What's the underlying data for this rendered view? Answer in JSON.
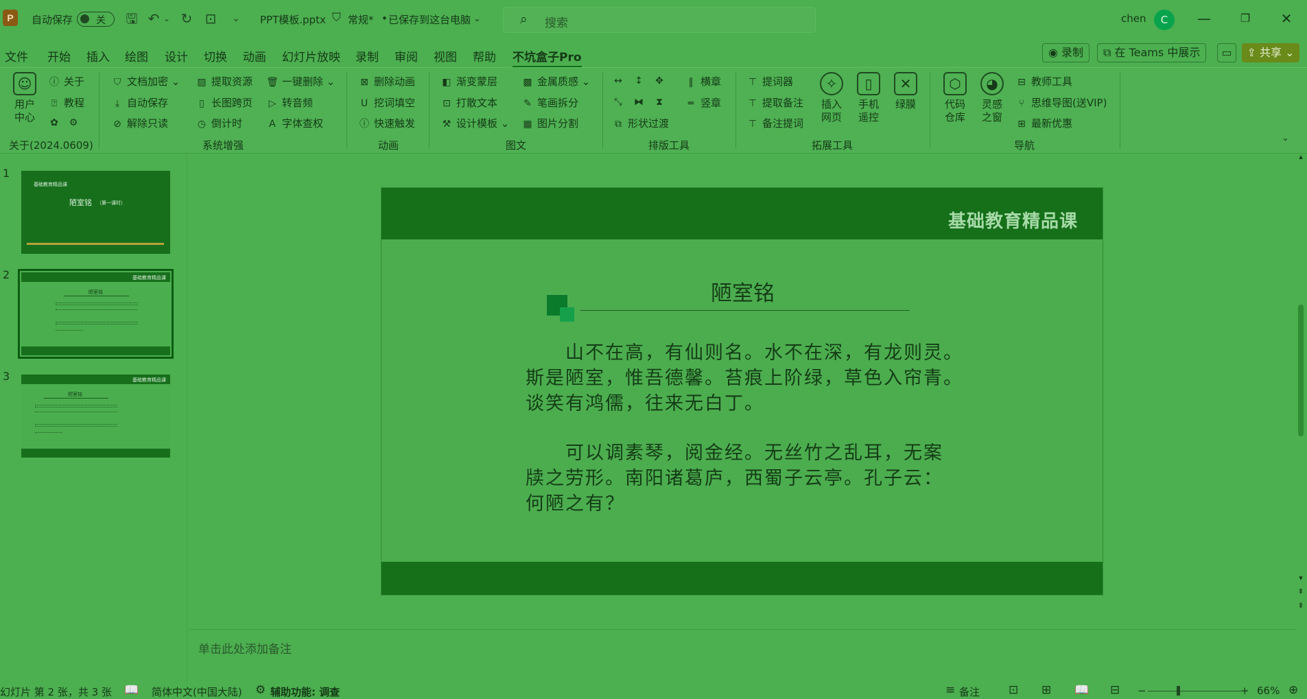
{
  "titlebar": {
    "autosave_label": "自动保存",
    "autosave_state": "关",
    "filename": "PPT模板.pptx",
    "sensitivity": "常规*",
    "saved_status": "已保存到这台电脑",
    "search_placeholder": "搜索",
    "username": "chen",
    "avatar_letter": "C"
  },
  "menu": {
    "tabs": [
      "文件",
      "开始",
      "插入",
      "绘图",
      "设计",
      "切换",
      "动画",
      "幻灯片放映",
      "录制",
      "审阅",
      "视图",
      "帮助",
      "不坑盒子Pro"
    ],
    "active_index": 12,
    "record_button": "录制",
    "teams_button": "在 Teams 中展示",
    "share_button": "共享"
  },
  "ribbon": {
    "about": {
      "user_center": "用户中心",
      "about": "关于",
      "tutorial": "教程",
      "group": "关于(2024.0609)"
    },
    "system": {
      "items": [
        "文档加密",
        "自动保存",
        "解除只读",
        "提取资源",
        "长图跨页",
        "倒计时",
        "一键删除",
        "转音频",
        "字体查权"
      ],
      "group": "系统增强"
    },
    "animation": {
      "items": [
        "删除动画",
        "挖词填空",
        "快速触发"
      ],
      "group": "动画"
    },
    "graphic": {
      "items": [
        "渐变蒙层",
        "打散文本",
        "设计模板",
        "金属质感",
        "笔画拆分",
        "图片分割"
      ],
      "group": "图文"
    },
    "layout": {
      "items": [
        "横章",
        "竖章",
        "形状过渡"
      ],
      "group": "排版工具"
    },
    "extend": {
      "items": [
        "提词器",
        "提取备注",
        "备注提词"
      ],
      "big": [
        "插入网页",
        "手机遥控",
        "绿膜"
      ],
      "group": "拓展工具"
    },
    "nav": {
      "big": [
        "代码仓库",
        "灵感之窗"
      ],
      "items": [
        "教师工具",
        "思维导图(送VIP)",
        "最新优惠"
      ],
      "group": "导航"
    }
  },
  "thumbnails": [
    {
      "num": "1",
      "title": "陋室铭",
      "subtitle": "（第一课时）",
      "brand": "基础教育精品课"
    },
    {
      "num": "2",
      "title": "陋室铭",
      "brand": "基础教育精品课"
    },
    {
      "num": "3",
      "title": "陋室铭",
      "brand": "基础教育精品课"
    }
  ],
  "slide": {
    "brand": "基础教育精品课",
    "title": "陋室铭",
    "para1": [
      "　　山不在高，有仙则名。水不在深，有龙则灵。",
      "斯是陋室，惟吾德馨。苔痕上阶绿，草色入帘青。",
      "谈笑有鸿儒，往来无白丁。"
    ],
    "para2": [
      "　　可以调素琴，阅金经。无丝竹之乱耳，无案",
      "牍之劳形。南阳诸葛庐，西蜀子云亭。孔子云：",
      "何陋之有？"
    ]
  },
  "notes_placeholder": "单击此处添加备注",
  "statusbar": {
    "slide_info": "幻灯片 第 2 张，共 3 张",
    "language": "简体中文(中国大陆)",
    "accessibility": "辅助功能: 调查",
    "notes": "备注",
    "zoom": "66%"
  }
}
